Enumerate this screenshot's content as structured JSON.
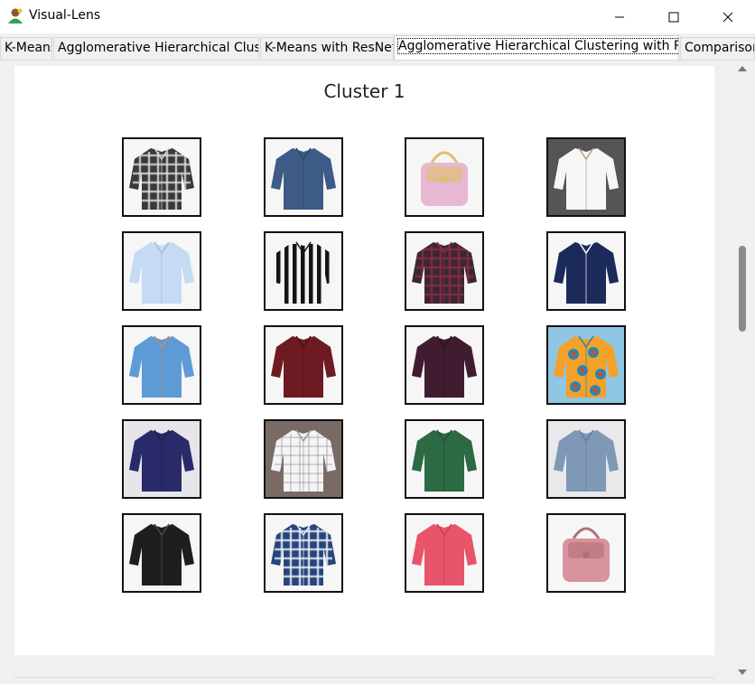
{
  "window": {
    "title": "Visual-Lens"
  },
  "tabs": [
    {
      "label": "K-Means",
      "active": false
    },
    {
      "label": "Agglomerative Hierarchical Clustering",
      "active": false
    },
    {
      "label": "K-Means with ResNet",
      "active": false
    },
    {
      "label": "Agglomerative Hierarchical Clustering with ResNet",
      "active": true
    },
    {
      "label": "Comparison",
      "active": false
    }
  ],
  "cluster": {
    "title": "Cluster 1",
    "items": [
      {
        "kind": "shirt",
        "color": "#3a3a3a",
        "accent": "#d8d8d8",
        "pattern": "plaid"
      },
      {
        "kind": "shirt",
        "color": "#3e5a86",
        "accent": "#2f4669",
        "pattern": "solid"
      },
      {
        "kind": "bag",
        "color": "#e8b7d4",
        "accent": "#e0c06a",
        "pattern": "solid"
      },
      {
        "kind": "shirt",
        "color": "#f6f6f6",
        "accent": "#b9a27a",
        "pattern": "solid",
        "bg": "#555555"
      },
      {
        "kind": "shirt",
        "color": "#c6daf4",
        "accent": "#9fbbe0",
        "pattern": "solid"
      },
      {
        "kind": "shirt",
        "color": "#f2f2f2",
        "accent": "#141414",
        "pattern": "stripes"
      },
      {
        "kind": "shirt",
        "color": "#3b2638",
        "accent": "#8a2f3c",
        "pattern": "plaid"
      },
      {
        "kind": "shirt",
        "color": "#1c2a5a",
        "accent": "#ffffff",
        "pattern": "solid"
      },
      {
        "kind": "shirt",
        "color": "#5d9ad6",
        "accent": "#c98a6a",
        "pattern": "solid"
      },
      {
        "kind": "shirt",
        "color": "#6e1a22",
        "accent": "#501218",
        "pattern": "solid"
      },
      {
        "kind": "shirt",
        "color": "#3f1c30",
        "accent": "#2c1222",
        "pattern": "solid"
      },
      {
        "kind": "shirt",
        "color": "#f2a12a",
        "accent": "#2a86b0",
        "pattern": "floral",
        "bg": "#8fc6e3"
      },
      {
        "kind": "shirt",
        "color": "#2a2a6a",
        "accent": "#1c1c4a",
        "pattern": "solid",
        "bg": "#e6e6ea"
      },
      {
        "kind": "shirt",
        "color": "#f4f4f4",
        "accent": "#9a9aa0",
        "pattern": "check",
        "bg": "#7a6a66"
      },
      {
        "kind": "shirt",
        "color": "#2c6a44",
        "accent": "#1f4f33",
        "pattern": "solid"
      },
      {
        "kind": "shirt",
        "color": "#7e98b6",
        "accent": "#62809f",
        "pattern": "solid",
        "bg": "#e9e9ec"
      },
      {
        "kind": "shirt",
        "color": "#1e1e1e",
        "accent": "#4a4a4a",
        "pattern": "solid"
      },
      {
        "kind": "shirt",
        "color": "#27457a",
        "accent": "#e8eef8",
        "pattern": "plaid"
      },
      {
        "kind": "shirt",
        "color": "#e8546a",
        "accent": "#c9404f",
        "pattern": "solid"
      },
      {
        "kind": "bag",
        "color": "#d9939c",
        "accent": "#b36f79",
        "pattern": "solid"
      }
    ]
  }
}
